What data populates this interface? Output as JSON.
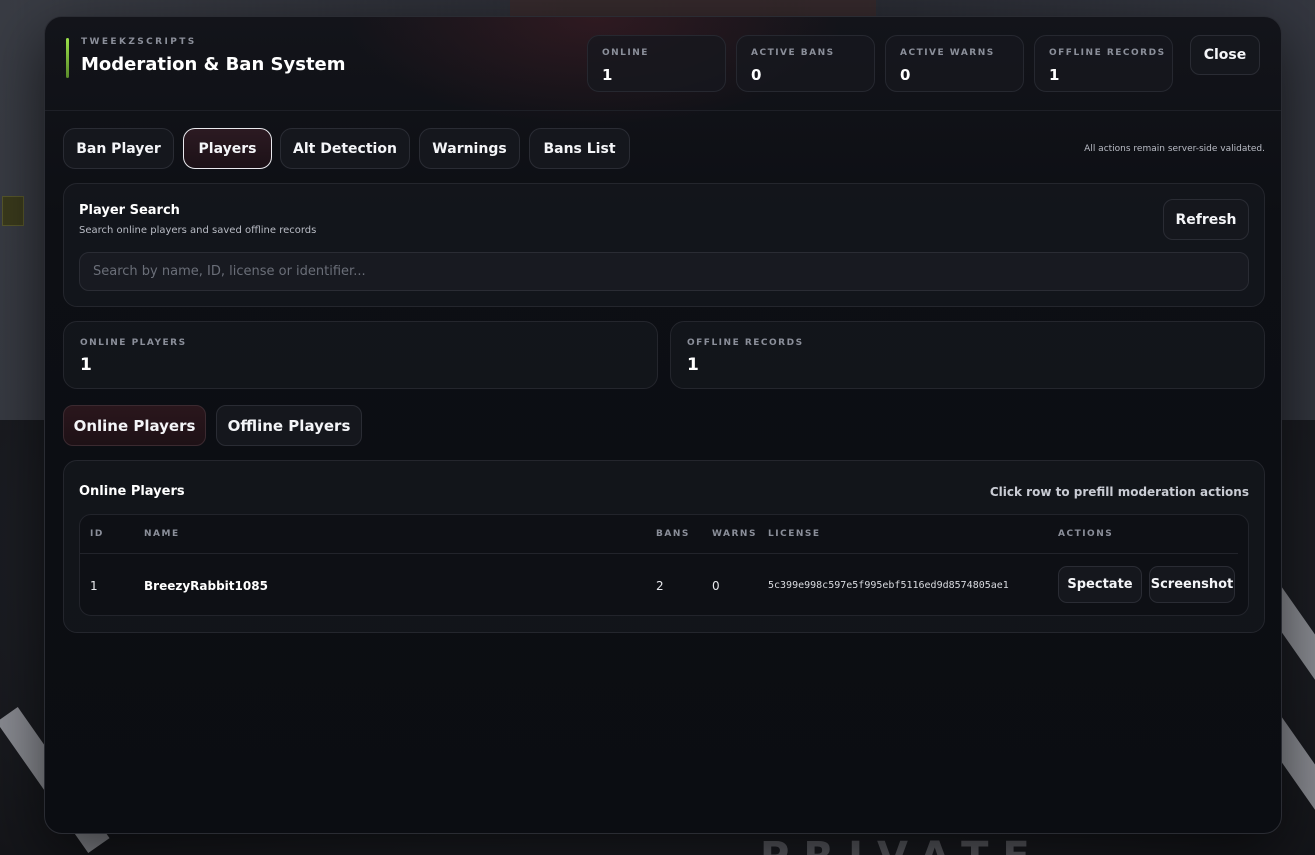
{
  "header": {
    "brand_sub": "TWEEKZSCRIPTS",
    "title": "Moderation & Ban System",
    "close_label": "Close",
    "stats": [
      {
        "label": "ONLINE",
        "value": "1"
      },
      {
        "label": "ACTIVE BANS",
        "value": "0"
      },
      {
        "label": "ACTIVE WARNS",
        "value": "0"
      },
      {
        "label": "OFFLINE RECORDS",
        "value": "1"
      }
    ]
  },
  "tabs": [
    {
      "label": "Ban Player",
      "active": false
    },
    {
      "label": "Players",
      "active": true
    },
    {
      "label": "Alt Detection",
      "active": false
    },
    {
      "label": "Warnings",
      "active": false
    },
    {
      "label": "Bans List",
      "active": false
    }
  ],
  "note": "All actions remain server-side validated.",
  "search": {
    "title": "Player Search",
    "subtitle": "Search online players and saved offline records",
    "refresh_label": "Refresh",
    "value": "",
    "placeholder": "Search by name, ID, license or identifier..."
  },
  "kpis": [
    {
      "label": "ONLINE PLAYERS",
      "value": "1"
    },
    {
      "label": "OFFLINE RECORDS",
      "value": "1"
    }
  ],
  "sub_tabs": [
    {
      "label": "Online Players",
      "active": true
    },
    {
      "label": "Offline Players",
      "active": false
    }
  ],
  "players_table": {
    "title": "Online Players",
    "hint": "Click row to prefill moderation actions",
    "columns": [
      "ID",
      "NAME",
      "BANS",
      "WARNS",
      "LICENSE",
      "ACTIONS"
    ],
    "rows": [
      {
        "id": "1",
        "name": "BreezyRabbit1085",
        "bans": "2",
        "warns": "0",
        "license": "5c399e998c597e5f995ebf5116ed9d8574805ae1",
        "actions": [
          "Spectate",
          "Screenshot"
        ]
      }
    ]
  },
  "background_text": "PRIVATE",
  "colors": {
    "accent_green": "#9be04a",
    "panel_bg": "#0b0d12",
    "active_tab_bg": "#2c1a22",
    "muted_text": "#8b8f9a"
  }
}
